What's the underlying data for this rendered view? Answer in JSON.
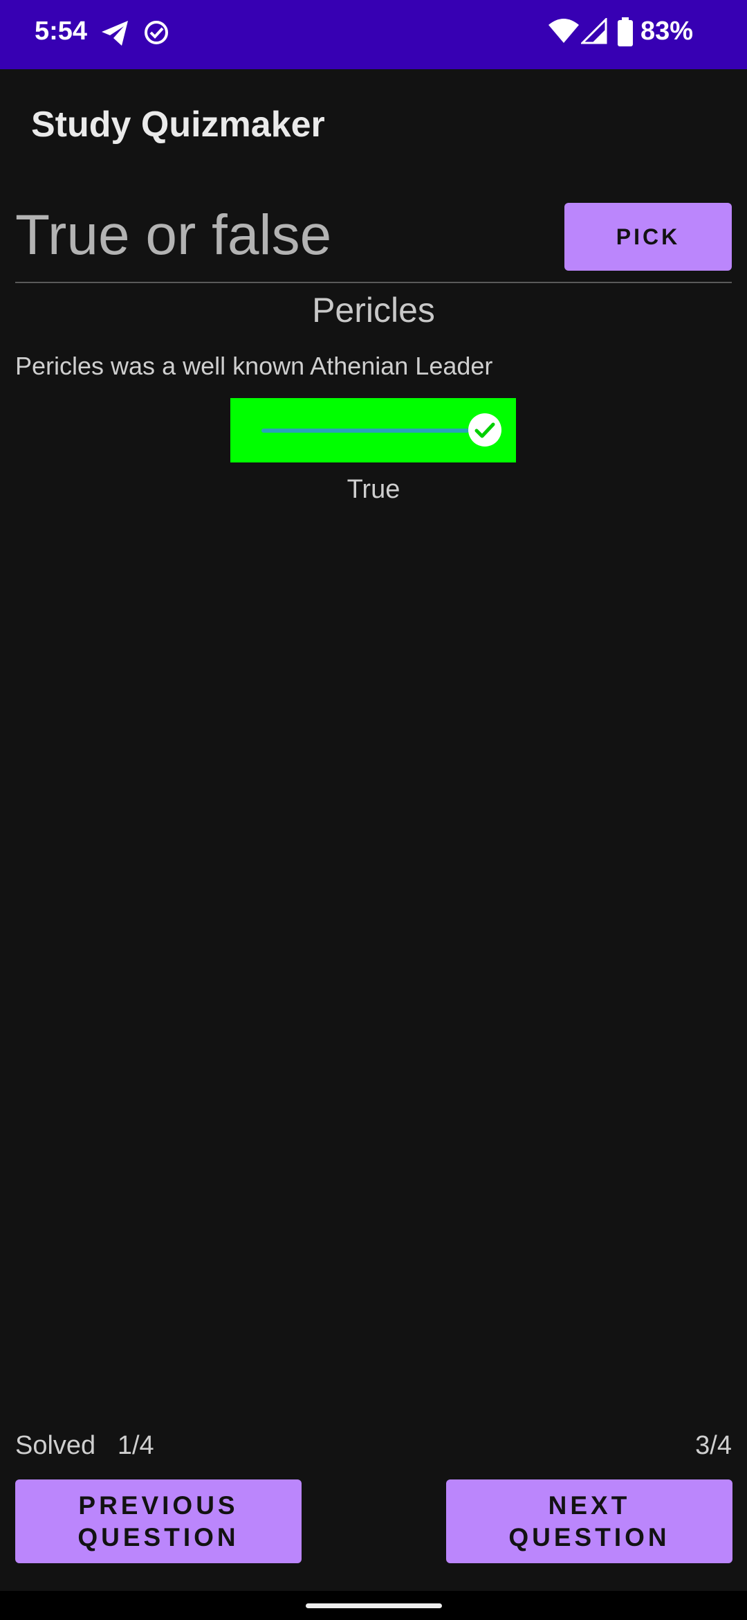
{
  "status_bar": {
    "time": "5:54",
    "battery_percent": "83%",
    "icons": [
      "telegram-icon",
      "check-circle-icon",
      "wifi-icon",
      "signal-icon",
      "battery-icon"
    ]
  },
  "app_bar": {
    "title": "Study Quizmaker"
  },
  "question_type": {
    "value": "True or false"
  },
  "pick_button": {
    "label": "PICK"
  },
  "question": {
    "title": "Pericles",
    "text": "Pericles was a well known Athenian Leader",
    "answer_switch_on": true,
    "answer_label": "True"
  },
  "progress": {
    "solved": "Solved   1/4",
    "position": "3/4"
  },
  "navigation": {
    "previous_line1": "PREVIOUS",
    "previous_line2": "QUESTION",
    "next_line1": "NEXT",
    "next_line2": "QUESTION"
  },
  "colors": {
    "status_bar": "#3700b3",
    "background": "#121212",
    "accent_button": "#bb86fc",
    "correct_highlight": "#00ff00"
  }
}
